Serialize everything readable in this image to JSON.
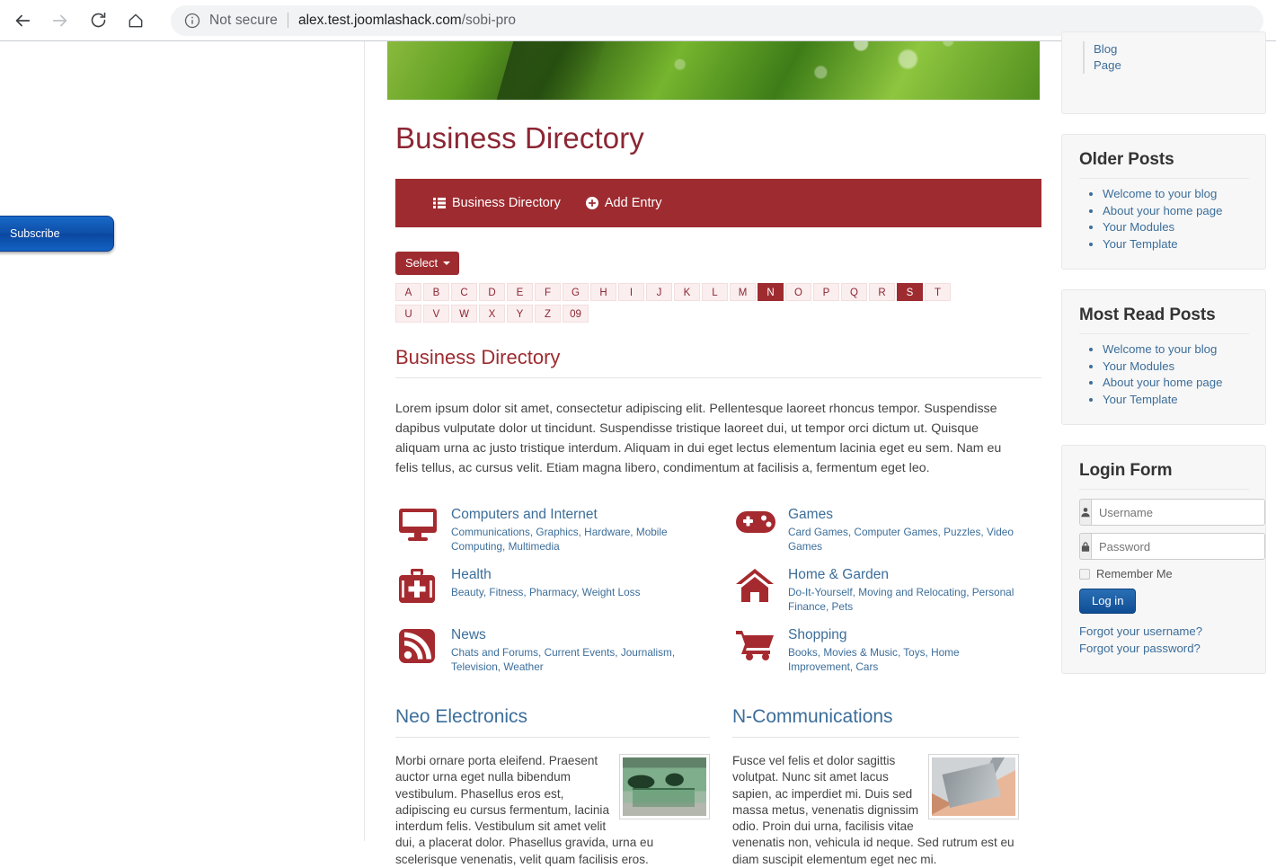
{
  "browser": {
    "back_icon": "back-arrow-icon",
    "forward_icon": "forward-arrow-icon",
    "reload_icon": "reload-icon",
    "home_icon": "home-icon",
    "info_icon": "info-circle-icon",
    "security_label": "Not secure",
    "url_host": "alex.test.joomlashack.com",
    "url_path": "/sobi-pro"
  },
  "left_gutter": {
    "subscribe_label": "Subscribe"
  },
  "main": {
    "hero_alt": "green-leaf-water-drops-banner",
    "page_title": "Business Directory",
    "toolbar": {
      "directory_label": "Business Directory",
      "directory_icon": "list-icon",
      "add_entry_label": "Add Entry",
      "add_entry_icon": "plus-circle-icon"
    },
    "select_label": "Select",
    "alphabet": [
      {
        "label": "A",
        "active": false
      },
      {
        "label": "B",
        "active": false
      },
      {
        "label": "C",
        "active": false
      },
      {
        "label": "D",
        "active": false
      },
      {
        "label": "E",
        "active": false
      },
      {
        "label": "F",
        "active": false
      },
      {
        "label": "G",
        "active": false
      },
      {
        "label": "H",
        "active": false
      },
      {
        "label": "I",
        "active": false
      },
      {
        "label": "J",
        "active": false
      },
      {
        "label": "K",
        "active": false
      },
      {
        "label": "L",
        "active": false
      },
      {
        "label": "M",
        "active": false
      },
      {
        "label": "N",
        "active": true
      },
      {
        "label": "O",
        "active": false
      },
      {
        "label": "P",
        "active": false
      },
      {
        "label": "Q",
        "active": false
      },
      {
        "label": "R",
        "active": false
      },
      {
        "label": "S",
        "active": true
      },
      {
        "label": "T",
        "active": false
      },
      {
        "label": "U",
        "active": false
      },
      {
        "label": "V",
        "active": false
      },
      {
        "label": "W",
        "active": false
      },
      {
        "label": "X",
        "active": false
      },
      {
        "label": "Y",
        "active": false
      },
      {
        "label": "Z",
        "active": false
      },
      {
        "label": "09",
        "active": false
      }
    ],
    "section_title": "Business Directory",
    "intro": "Lorem ipsum dolor sit amet, consectetur adipiscing elit. Pellentesque laoreet rhoncus tempor. Suspendisse dapibus vulputate dolor ut tincidunt. Suspendisse tristique laoreet dui, ut tempor orci dictum ut. Quisque aliquam urna ac justo tristique interdum. Aliquam in dui eget lectus elementum lacinia eget eu sem. Nam eu felis tellus, ac cursus velit. Etiam magna libero, condimentum at facilisis a, fermentum eget leo.",
    "categories": [
      {
        "icon": "monitor-icon",
        "name": "Computers and Internet",
        "subs": "Communications, Graphics, Hardware, Mobile Computing, Multimedia"
      },
      {
        "icon": "gamepad-icon",
        "name": "Games",
        "subs": "Card Games, Computer Games, Puzzles, Video Games"
      },
      {
        "icon": "medkit-icon",
        "name": "Health",
        "subs": "Beauty, Fitness, Pharmacy, Weight Loss"
      },
      {
        "icon": "house-icon",
        "name": "Home & Garden",
        "subs": "Do-It-Yourself, Moving and Relocating, Personal Finance, Pets"
      },
      {
        "icon": "rss-icon",
        "name": "News",
        "subs": "Chats and Forums, Current Events, Journalism, Television, Weather"
      },
      {
        "icon": "shopping-cart-icon",
        "name": "Shopping",
        "subs": "Books, Movies & Music, Toys, Home Improvement, Cars"
      }
    ],
    "entries": [
      {
        "title": "Neo Electronics",
        "thumb": "green-industrial-machine-photo",
        "text": "Morbi ornare porta eleifend. Praesent auctor urna eget nulla bibendum vestibulum. Phasellus eros est, adipiscing eu cursus fermentum, lacinia interdum felis. Vestibulum sit amet velit dui, a placerat dolor. Phasellus gravida, urna eu scelerisque venenatis, velit quam facilisis eros."
      },
      {
        "title": "N-Communications",
        "thumb": "hand-holding-smartphone-photo",
        "text": "Fusce vel felis et dolor sagittis volutpat. Nunc sit amet lacus sapien, ac imperdiet mi. Duis sed massa metus, venenatis dignissim odio. Proin dui urna, facilisis vitae venenatis non, vehicula id neque. Sed rutrum est eu diam suscipit elementum eget nec mi."
      }
    ]
  },
  "sidebar": {
    "nav_module": {
      "items": [
        "Blog",
        "Page"
      ]
    },
    "older_posts": {
      "title": "Older Posts",
      "items": [
        "Welcome to your blog",
        "About your home page",
        "Your Modules",
        "Your Template"
      ]
    },
    "most_read": {
      "title": "Most Read Posts",
      "items": [
        "Welcome to your blog",
        "Your Modules",
        "About your home page",
        "Your Template"
      ]
    },
    "login": {
      "title": "Login Form",
      "username_placeholder": "Username",
      "username_icon": "user-icon",
      "password_placeholder": "Password",
      "password_icon": "lock-icon",
      "remember_label": "Remember Me",
      "login_button": "Log in",
      "forgot_username": "Forgot your username?",
      "forgot_password": "Forgot your password?"
    }
  },
  "colors": {
    "brand_red": "#9e2b30",
    "title_red": "#8c2633",
    "link_blue": "#3c6e9a",
    "login_blue": "#0f4e95"
  }
}
